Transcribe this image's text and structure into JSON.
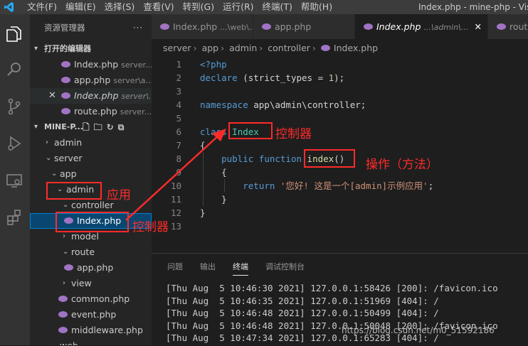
{
  "menu": [
    "文件(F)",
    "编辑(E)",
    "选择(S)",
    "查看(V)",
    "转到(G)",
    "运行(R)",
    "终端(T)",
    "帮助(H)"
  ],
  "window_title": "Index.php - mine-php - Visua",
  "sidebar": {
    "title": "资源管理器",
    "more": "···",
    "open_editors_header": "打开的编辑器",
    "open_editors": [
      {
        "name": "Index.php",
        "path": "server..."
      },
      {
        "name": "app.php",
        "path": "server\\a..."
      },
      {
        "name": "Index.php",
        "path": "server\\..."
      },
      {
        "name": "route.php",
        "path": "server..."
      }
    ],
    "close_mark": "✕",
    "workspace_header": "MINE-P...",
    "tree": {
      "admin_top": "admin",
      "server": "server",
      "app": "app",
      "admin": "admin",
      "controller": "controller",
      "index": "Index.php",
      "model": "model",
      "route": "route",
      "app_php": "app.php",
      "view": "view",
      "common": "common.php",
      "event": "event.php",
      "middleware": "middleware.php",
      "partial": "···web"
    }
  },
  "tabs": [
    {
      "name": "Index.php",
      "sub": "...\\web\\..."
    },
    {
      "name": "app.php",
      "sub": ""
    },
    {
      "name": "Index.php",
      "sub": "...\\admin\\..."
    },
    {
      "name": "route",
      "sub": ""
    }
  ],
  "tab_close": "✕",
  "breadcrumb": [
    "server",
    "app",
    "admin",
    "controller",
    "Index.php"
  ],
  "breadcrumb_sep": "›",
  "code": {
    "line_numbers": [
      "1",
      "2",
      "3",
      "4",
      "5",
      "6",
      "7",
      "8",
      "9",
      "10",
      "11",
      "12",
      "13"
    ],
    "l1": "<?php",
    "l2_kw": "declare",
    "l2_rest": " (strict_types = ",
    "l2_num": "1",
    "l2_end": ");",
    "l4_kw": "namespace",
    "l4_ns": " app\\admin\\controller;",
    "l6_kw": "class",
    "l6_cls": "Index",
    "l7": "{",
    "l8_kw1": "public",
    "l8_kw2": "function",
    "l8_fn": "index",
    "l8_paren": "()",
    "l9": "{",
    "l10_kw": "return",
    "l10_str": "'您好! 这是一个[admin]示例应用'",
    "l10_end": ";",
    "l11": "}",
    "l12": "}"
  },
  "panel": {
    "tabs": [
      "问题",
      "输出",
      "终端",
      "调试控制台"
    ],
    "active_tab": "终端",
    "terminal_lines": [
      "[Thu Aug  5 10:46:30 2021] 127.0.0.1:58426 [200]: /favicon.ico",
      "[Thu Aug  5 10:46:35 2021] 127.0.0.1:51969 [404]: /",
      "[Thu Aug  5 10:46:48 2021] 127.0.0.1:50499 [404]: /",
      "[Thu Aug  5 10:46:48 2021] 127.0.0.1:50048 [200]: /favicon.ico",
      "[Thu Aug  5 10:47:34 2021] 127.0.0.1:65283 [404]: /"
    ]
  },
  "annotations": {
    "controller_label": "控制器",
    "action_label": "操作（方法）",
    "app_label": "应用",
    "file_label": "控制器"
  },
  "watermark": "https://blog.csdn.net/m0_51592186",
  "colors": {
    "annotation": "#ff2b2b",
    "keyword": "#569cd6",
    "class": "#4ec9b0",
    "function": "#dcdcaa",
    "string": "#ce9178",
    "php_icon": "#a074c4"
  }
}
